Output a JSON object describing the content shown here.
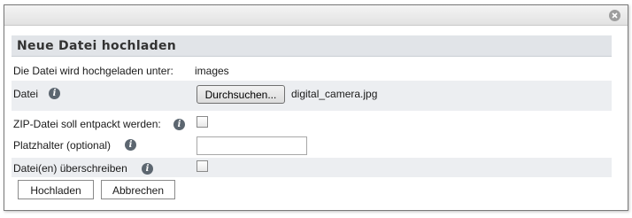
{
  "dialog": {
    "close_icon": "close-circle-icon",
    "panel_title": "Neue Datei hochladen"
  },
  "form": {
    "upload_target": {
      "label": "Die Datei wird hochgeladen unter:",
      "value": "images"
    },
    "file": {
      "label": "Datei",
      "info_icon": "info-icon",
      "browse_label": "Durchsuchen...",
      "selected_file": "digital_camera.jpg"
    },
    "unzip": {
      "label": "ZIP-Datei soll entpackt werden:",
      "info_icon": "info-icon",
      "checked": false
    },
    "placeholder": {
      "label": "Platzhalter (optional)",
      "info_icon": "info-icon",
      "value": ""
    },
    "overwrite": {
      "label": "Datei(en) überschreiben",
      "info_icon": "info-icon",
      "checked": false
    }
  },
  "actions": {
    "upload_label": "Hochladen",
    "cancel_label": "Abbrechen"
  },
  "colors": {
    "header_bg": "#e1e4e8",
    "row_shade": "#eceef1",
    "info_icon": "#5c6670"
  }
}
